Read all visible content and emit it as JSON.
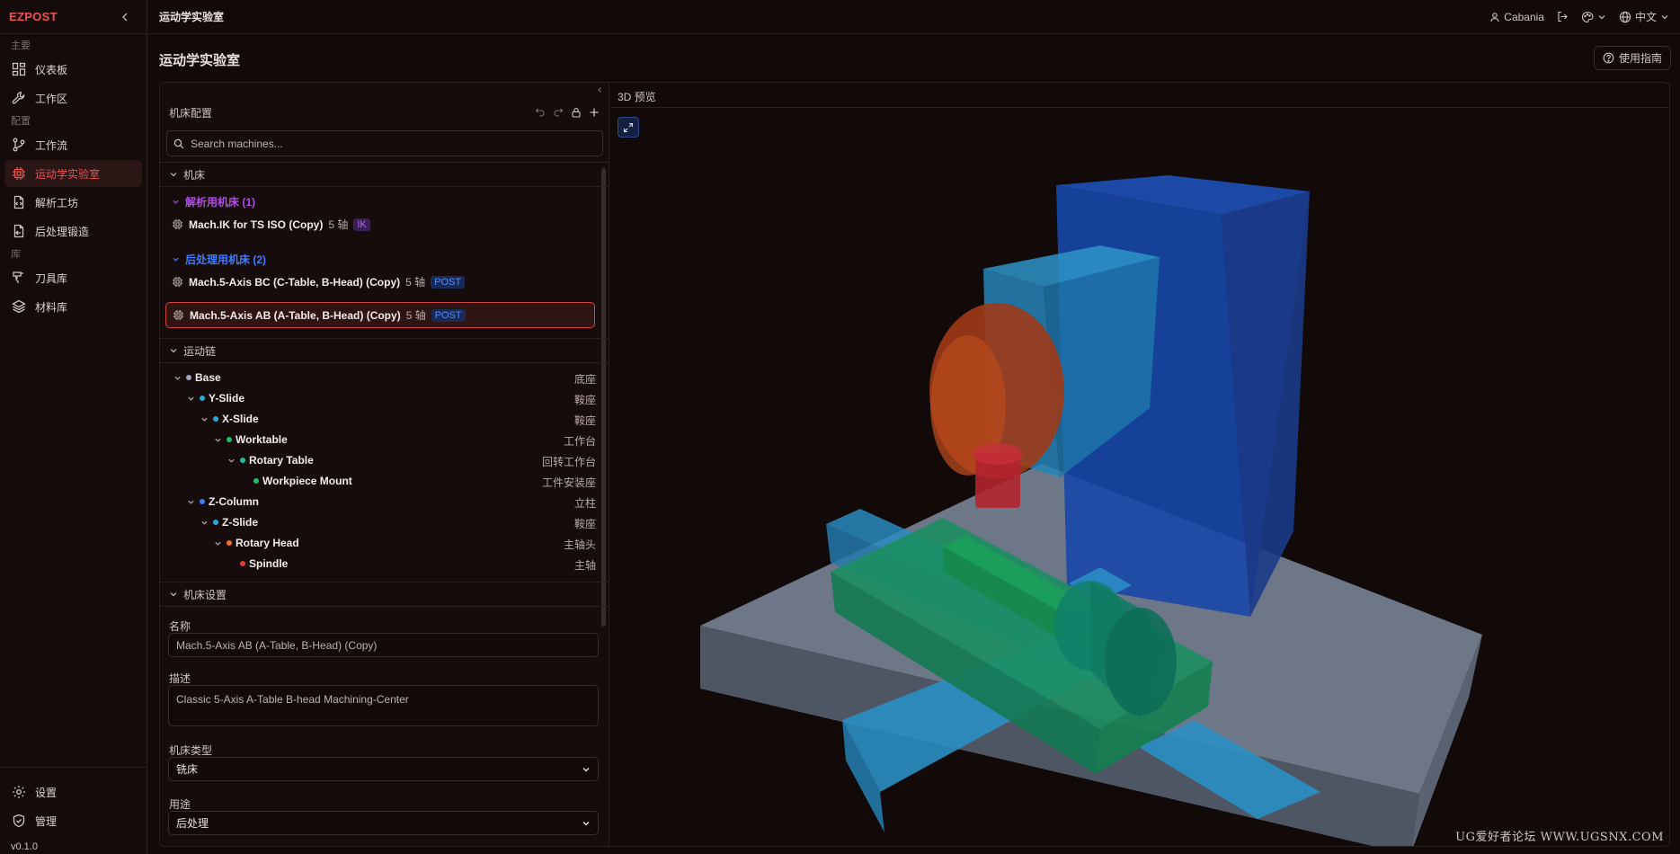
{
  "sidebar": {
    "brand": "EZPOST",
    "sections": [
      {
        "label": "主要",
        "items": [
          {
            "label": "仪表板",
            "icon": "dashboard-icon"
          },
          {
            "label": "工作区",
            "icon": "wrench-icon"
          }
        ]
      },
      {
        "label": "配置",
        "items": [
          {
            "label": "工作流",
            "icon": "workflow-icon"
          },
          {
            "label": "运动学实验室",
            "icon": "chip-icon",
            "active": true
          },
          {
            "label": "解析工坊",
            "icon": "file-code-icon"
          },
          {
            "label": "后处理锻造",
            "icon": "file-export-icon"
          }
        ]
      },
      {
        "label": "库",
        "items": [
          {
            "label": "刀具库",
            "icon": "drill-icon"
          },
          {
            "label": "材料库",
            "icon": "layers-icon"
          }
        ]
      }
    ],
    "bottom": {
      "settings": "设置",
      "admin": "管理",
      "version": "v0.1.0"
    }
  },
  "topbar": {
    "title": "运动学实验室",
    "user": "Cabania",
    "language": "中文"
  },
  "page": {
    "title": "运动学实验室",
    "guide_button": "使用指南"
  },
  "config": {
    "title": "机床配置",
    "search_placeholder": "Search machines...",
    "machines_section": "机床",
    "groups": [
      {
        "label": "解析用机床 (1)",
        "color": "#b24ce6",
        "machines": [
          {
            "name": "Mach.IK for TS ISO (Copy)",
            "axes": "5 轴",
            "badge": "IK"
          }
        ]
      },
      {
        "label": "后处理用机床 (2)",
        "color": "#3f7bff",
        "machines": [
          {
            "name": "Mach.5-Axis BC (C-Table, B-Head) (Copy)",
            "axes": "5 轴",
            "badge": "POST"
          },
          {
            "name": "Mach.5-Axis AB (A-Table, B-Head) (Copy)",
            "axes": "5 轴",
            "badge": "POST",
            "selected": true
          }
        ]
      }
    ],
    "chain_section": "运动链",
    "chain": [
      {
        "name": "Base",
        "role": "底座",
        "color": "#9fa8c0"
      },
      {
        "name": "Y-Slide",
        "role": "鞍座",
        "color": "#29a8e0"
      },
      {
        "name": "X-Slide",
        "role": "鞍座",
        "color": "#29a8e0"
      },
      {
        "name": "Worktable",
        "role": "工作台",
        "color": "#1fbf6a"
      },
      {
        "name": "Rotary Table",
        "role": "回转工作台",
        "color": "#1fbfa0"
      },
      {
        "name": "Workpiece Mount",
        "role": "工件安装座",
        "color": "#1fbf6a"
      },
      {
        "name": "Z-Column",
        "role": "立柱",
        "color": "#3f7bff"
      },
      {
        "name": "Z-Slide",
        "role": "鞍座",
        "color": "#29a8e0"
      },
      {
        "name": "Rotary Head",
        "role": "主轴头",
        "color": "#f07020"
      },
      {
        "name": "Spindle",
        "role": "主轴",
        "color": "#e53935"
      }
    ],
    "settings_section": "机床设置",
    "fields": {
      "name_label": "名称",
      "name_value": "Mach.5-Axis AB (A-Table, B-Head) (Copy)",
      "desc_label": "描述",
      "desc_value": "Classic 5-Axis A-Table B-head Machining-Center",
      "type_label": "机床类型",
      "type_value": "铣床",
      "usage_label": "用途",
      "usage_value": "后处理"
    }
  },
  "preview": {
    "title": "3D 预览",
    "watermark": "UG爱好者论坛 WWW.UGSNX.COM"
  },
  "colors": {
    "accent": "#ef5350",
    "ik": "#b24ce6",
    "post": "#3f7bff",
    "background": "#120909"
  }
}
